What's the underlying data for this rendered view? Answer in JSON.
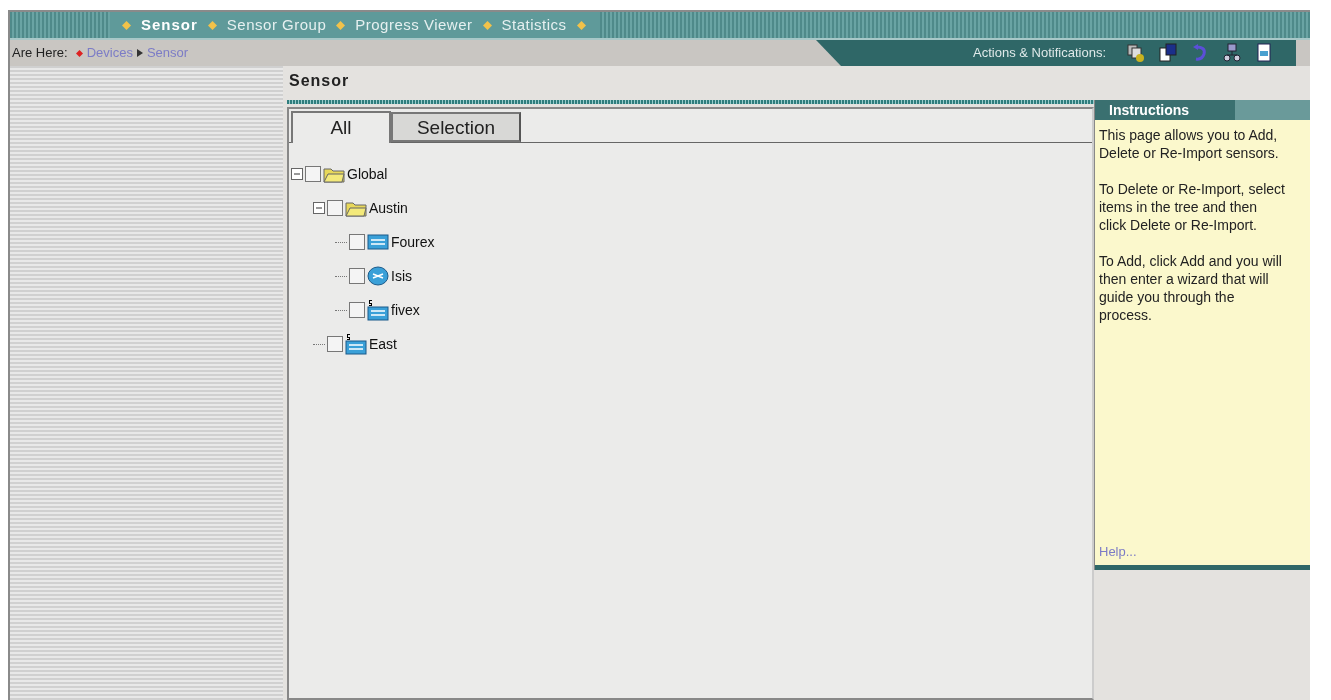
{
  "nav_tabs": [
    {
      "label": "Sensor",
      "selected": true
    },
    {
      "label": "Sensor Group",
      "selected": false
    },
    {
      "label": "Progress Viewer",
      "selected": false
    },
    {
      "label": "Statistics",
      "selected": false
    }
  ],
  "breadcrumb": {
    "prefix": "Are Here:",
    "items": [
      "Devices",
      "Sensor"
    ]
  },
  "actions": {
    "label": "Actions & Notifications:"
  },
  "page_title": "Sensor",
  "tabs": [
    {
      "label": "All",
      "selected": true
    },
    {
      "label": "Selection",
      "selected": false
    }
  ],
  "tree": [
    {
      "label": "Global",
      "kind": "folder",
      "checked": false,
      "expanded": true,
      "children": [
        {
          "label": "Austin",
          "kind": "folder",
          "checked": false,
          "expanded": true,
          "children": [
            {
              "label": "Fourex",
              "kind": "switch",
              "checked": false
            },
            {
              "label": "Isis",
              "kind": "router",
              "checked": false
            },
            {
              "label": "fivex",
              "kind": "switch5",
              "checked": false
            }
          ]
        },
        {
          "label": "East",
          "kind": "switch5",
          "checked": false
        }
      ]
    }
  ],
  "instructions": {
    "title": "Instructions",
    "paragraphs": [
      "This page allows you to Add, Delete or Re-Import sensors.",
      "To Delete or Re-Import, select items in the tree and then click Delete or Re-Import.",
      "To Add, click Add and you will then enter a wizard that will guide you through the process."
    ],
    "help_link": "Help..."
  }
}
